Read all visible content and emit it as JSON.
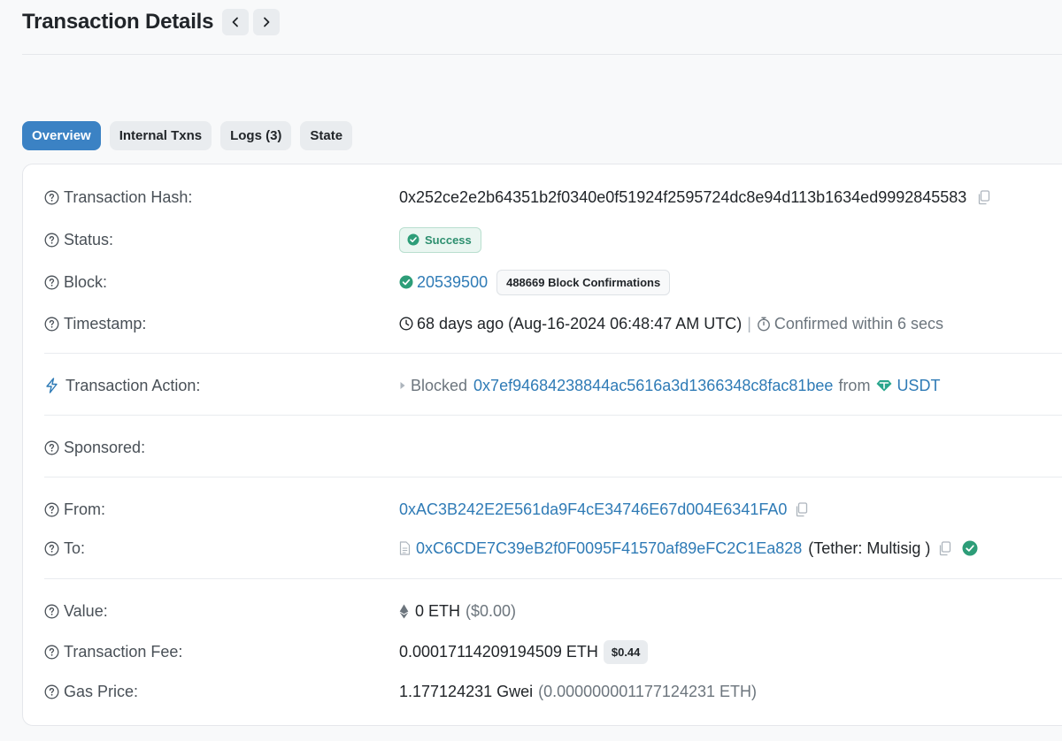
{
  "header": {
    "title": "Transaction Details"
  },
  "tabs": [
    {
      "label": "Overview"
    },
    {
      "label": "Internal Txns"
    },
    {
      "label": "Logs (3)"
    },
    {
      "label": "State"
    }
  ],
  "rows": {
    "hash": {
      "label": "Transaction Hash:",
      "value": "0x252ce2e2b64351b2f0340e0f51924f2595724dc8e94d113b1634ed9992845583"
    },
    "status": {
      "label": "Status:",
      "value": "Success"
    },
    "block": {
      "label": "Block:",
      "value": "20539500",
      "confirmations": "488669 Block Confirmations"
    },
    "timestamp": {
      "label": "Timestamp:",
      "value": "68 days ago (Aug-16-2024 06:48:47 AM UTC)",
      "separator": "|",
      "confirmed": "Confirmed within 6 secs"
    },
    "action": {
      "label": "Transaction Action:",
      "verb": "Blocked",
      "address": "0x7ef94684238844ac5616a3d1366348c8fac81bee",
      "from_word": "from",
      "token": "USDT"
    },
    "sponsored": {
      "label": "Sponsored:"
    },
    "from": {
      "label": "From:",
      "address": "0xAC3B242E2E561da9F4cE34746E67d004E6341FA0"
    },
    "to": {
      "label": "To:",
      "address": "0xC6CDE7C39eB2f0F0095F41570af89eFC2C1Ea828",
      "name": "(Tether: Multisig )"
    },
    "value": {
      "label": "Value:",
      "amount": "0 ETH",
      "usd": "($0.00)"
    },
    "fee": {
      "label": "Transaction Fee:",
      "amount": "0.00017114209194509 ETH",
      "usd": "$0.44"
    },
    "gas": {
      "label": "Gas Price:",
      "amount": "1.177124231 Gwei",
      "eth": "(0.000000001177124231 ETH)"
    }
  },
  "colors": {
    "link": "#2f7bb6",
    "success": "#2d8f6f",
    "tab_active": "#3b82c4"
  }
}
